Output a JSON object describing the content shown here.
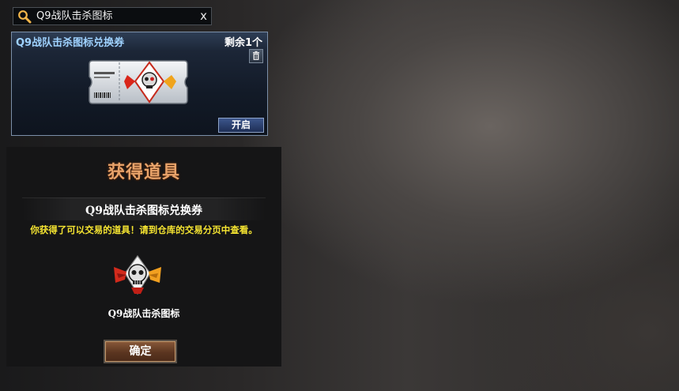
{
  "search": {
    "value": "Q9战队击杀图标",
    "clear_label": "x",
    "icon": "search-icon"
  },
  "voucher_card": {
    "title": "Q9战队击杀图标兑换券",
    "remaining": "剩余1个",
    "delete_icon": "trash-icon",
    "open_label": "开启"
  },
  "reward_dialog": {
    "heading": "获得道具",
    "item_name": "Q9战队击杀图标兑换券",
    "notice": "你获得了可以交易的道具！请到仓库的交易分页中查看。",
    "emblem_name": "Q9战队击杀图标",
    "confirm_label": "确定"
  },
  "colors": {
    "title_blue": "#9fd2ff",
    "notice_yellow": "#f5e431",
    "heading_orange": "#e8a36a"
  }
}
